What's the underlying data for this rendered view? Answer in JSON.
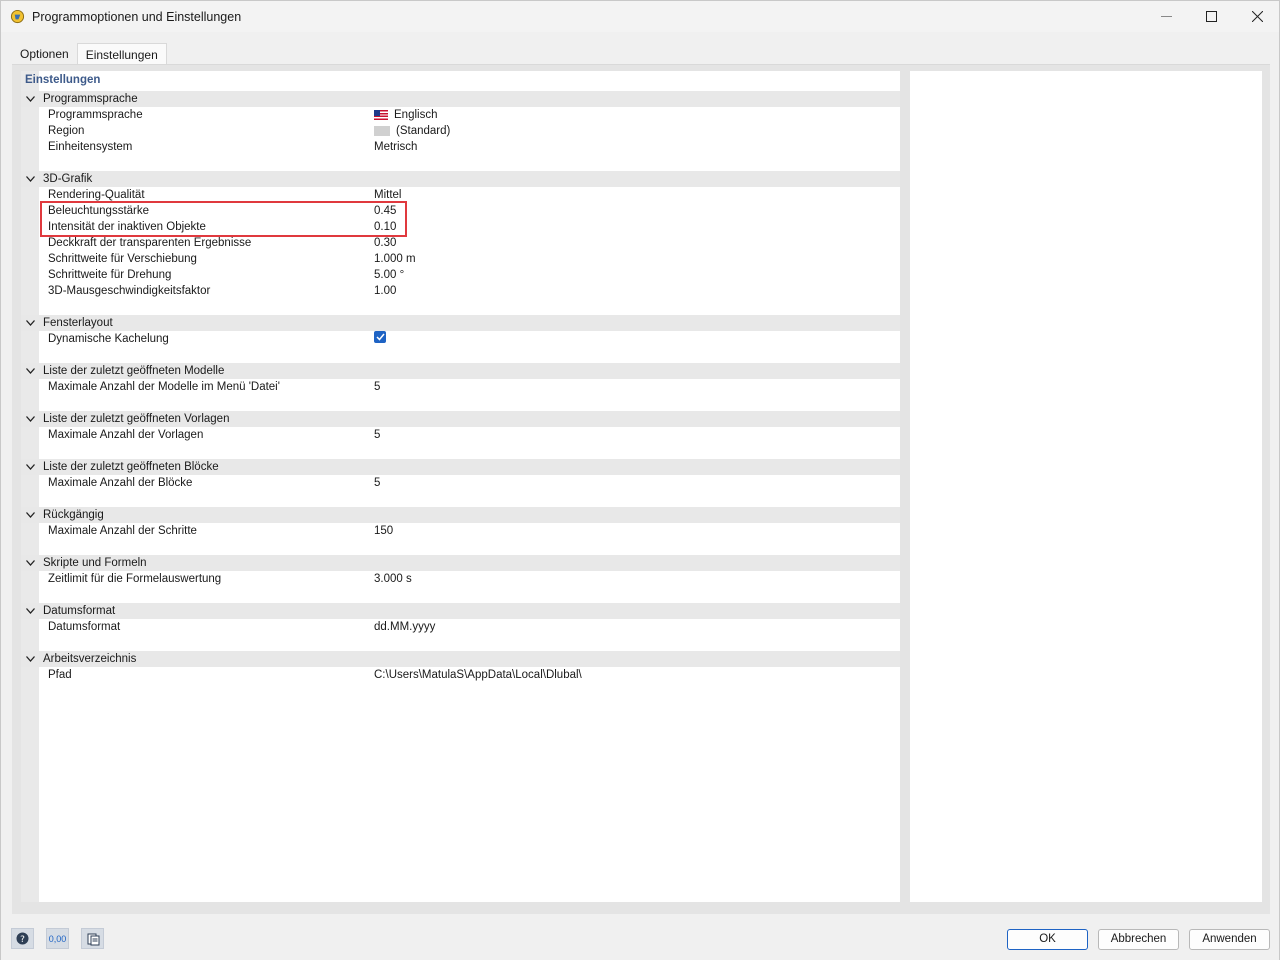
{
  "window": {
    "title": "Programmoptionen und Einstellungen"
  },
  "tabs": [
    {
      "label": "Optionen",
      "active": false
    },
    {
      "label": "Einstellungen",
      "active": true
    }
  ],
  "pane": {
    "header": "Einstellungen"
  },
  "groups": [
    {
      "title": "Programmsprache",
      "rows": [
        {
          "label": "Programmsprache",
          "value": "Englisch",
          "icon": "us-flag-icon"
        },
        {
          "label": "Region",
          "value": "(Standard)",
          "icon": "blank-flag-icon"
        },
        {
          "label": "Einheitensystem",
          "value": "Metrisch"
        }
      ]
    },
    {
      "title": "3D-Grafik",
      "rows": [
        {
          "label": "Rendering-Qualität",
          "value": "Mittel"
        },
        {
          "label": "Beleuchtungsstärke",
          "value": "0.45"
        },
        {
          "label": "Intensität der inaktiven Objekte",
          "value": "0.10"
        },
        {
          "label": "Deckkraft der transparenten Ergebnisse",
          "value": "0.30"
        },
        {
          "label": "Schrittweite für Verschiebung",
          "value": "1.000 m"
        },
        {
          "label": "Schrittweite für Drehung",
          "value": "5.00 °"
        },
        {
          "label": "3D-Mausgeschwindigkeitsfaktor",
          "value": "1.00"
        }
      ]
    },
    {
      "title": "Fensterlayout",
      "rows": [
        {
          "label": "Dynamische Kachelung",
          "value": "",
          "checkbox": true
        }
      ]
    },
    {
      "title": "Liste der zuletzt geöffneten Modelle",
      "rows": [
        {
          "label": "Maximale Anzahl der Modelle im Menü 'Datei'",
          "value": "5"
        }
      ]
    },
    {
      "title": "Liste der zuletzt geöffneten Vorlagen",
      "rows": [
        {
          "label": "Maximale Anzahl der Vorlagen",
          "value": "5"
        }
      ]
    },
    {
      "title": "Liste der zuletzt geöffneten Blöcke",
      "rows": [
        {
          "label": "Maximale Anzahl der Blöcke",
          "value": "5"
        }
      ]
    },
    {
      "title": "Rückgängig",
      "rows": [
        {
          "label": "Maximale Anzahl der Schritte",
          "value": "150"
        }
      ]
    },
    {
      "title": "Skripte und Formeln",
      "rows": [
        {
          "label": "Zeitlimit für die Formelauswertung",
          "value": "3.000 s"
        }
      ]
    },
    {
      "title": "Datumsformat",
      "rows": [
        {
          "label": "Datumsformat",
          "value": "dd.MM.yyyy"
        }
      ]
    },
    {
      "title": "Arbeitsverzeichnis",
      "rows": [
        {
          "label": "Pfad",
          "value": "C:\\Users\\MatulaS\\AppData\\Local\\Dlubal\\"
        }
      ]
    }
  ],
  "footer": {
    "units_icon_text": "0,00",
    "ok_label": "OK",
    "cancel_label": "Abbrechen",
    "apply_label": "Anwenden"
  },
  "colors": {
    "accent": "#1e63c4",
    "highlight": "#e0393e",
    "header_text": "#3d5a8a"
  }
}
